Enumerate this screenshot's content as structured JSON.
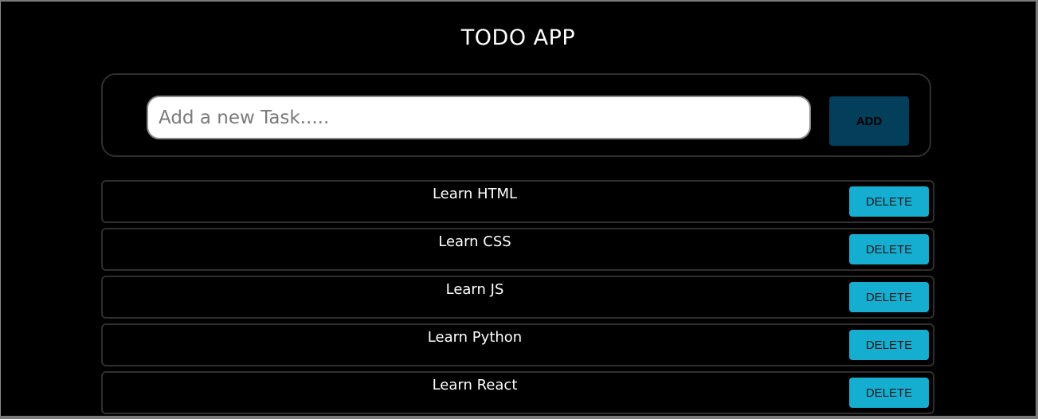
{
  "app": {
    "title": "TODO APP"
  },
  "new_task": {
    "placeholder": "Add a new Task.....",
    "value": "",
    "add_label": "ADD"
  },
  "tasks": [
    {
      "text": "Learn HTML",
      "delete_label": "DELETE"
    },
    {
      "text": "Learn CSS",
      "delete_label": "DELETE"
    },
    {
      "text": "Learn JS",
      "delete_label": "DELETE"
    },
    {
      "text": "Learn Python",
      "delete_label": "DELETE"
    },
    {
      "text": "Learn React",
      "delete_label": "DELETE"
    }
  ],
  "colors": {
    "background": "#000000",
    "add_button": "#033e5a",
    "delete_button": "#16aed0",
    "panel_border": "#2f2f2f",
    "text": "#ffffff"
  }
}
